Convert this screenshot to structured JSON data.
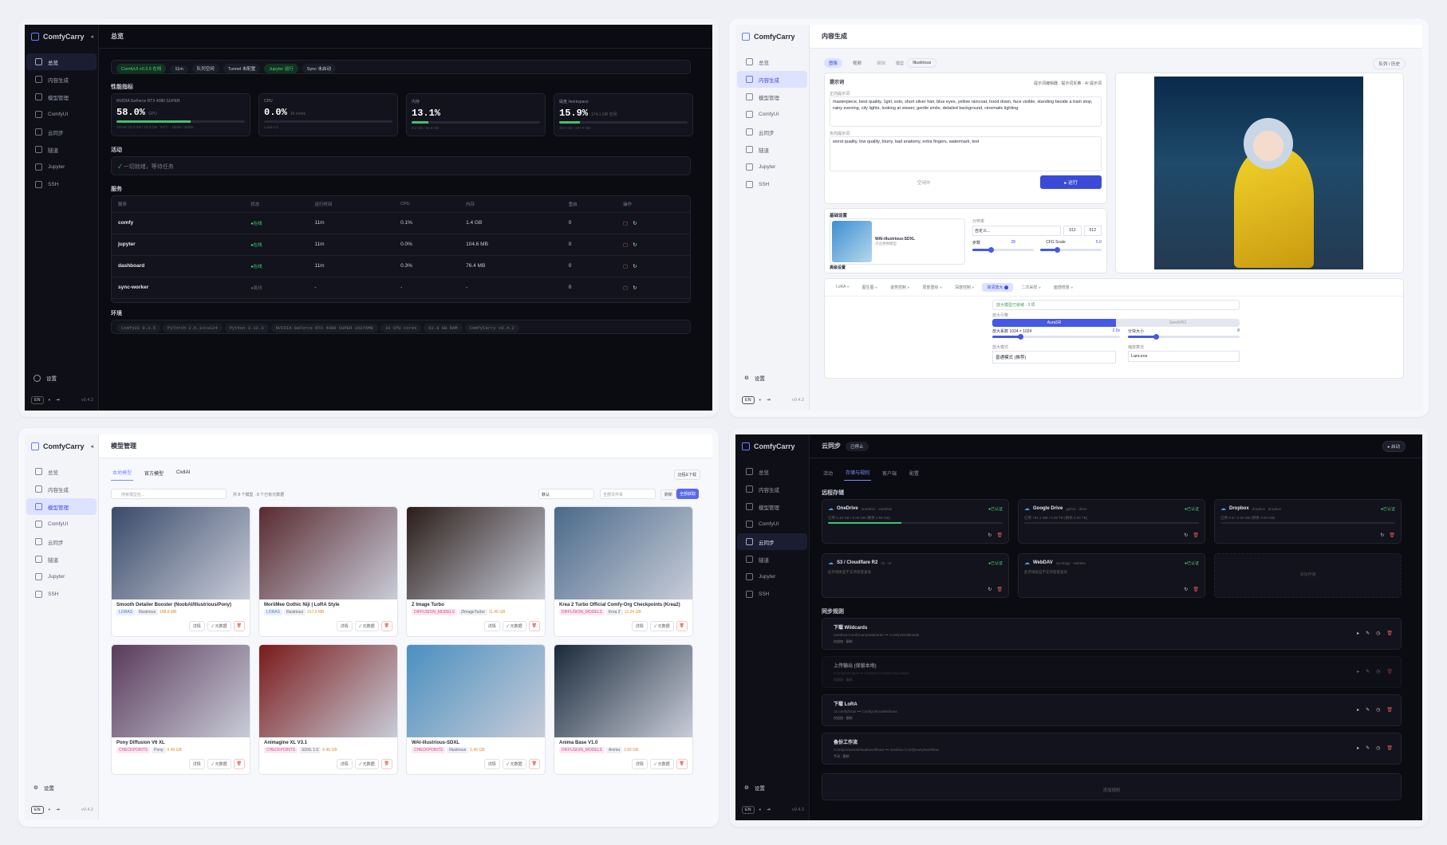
{
  "brand": {
    "name": "ComfyCarry",
    "collapse": "◂"
  },
  "nav": [
    "总览",
    "内容生成",
    "模型管理",
    "ComfyUI",
    "云同步",
    "隧道",
    "Jupyter",
    "SSH"
  ],
  "settings": "设置",
  "footer": {
    "lang": "EN",
    "ver": "v0.4.2"
  },
  "overview": {
    "title": "总览",
    "status": [
      "ComfyUI v0.3.5 在线",
      "11m",
      "队列空闲",
      "Tunnel 未配置",
      "Jupyter 运行",
      "Sync 未启动"
    ],
    "perf_title": "性能指标",
    "metrics": [
      {
        "label": "NVIDIA GeForce RTX 4080 SUPER",
        "value": "58.0%",
        "sub": "GPU",
        "foot": "VRAM 10.0 GB / 16.0 GB · 54°C · 150W / 320W",
        "pct": 58
      },
      {
        "label": "CPU",
        "value": "0.0%",
        "sub": "16 cores",
        "foot": "Load 0.0",
        "pct": 0
      },
      {
        "label": "内存",
        "value": "13.1%",
        "sub": "",
        "foot": "8.2 GB / 62.8 GB",
        "pct": 13.1
      },
      {
        "label": "磁盘 /workspace",
        "value": "15.9%",
        "sub": "174.1 GB 空闲",
        "foot": "32.9 GB / 207.0 GB",
        "pct": 15.9
      }
    ],
    "activity_title": "活动",
    "activity_text": "一切就绪，等待任务",
    "services_title": "服务",
    "svc_headers": [
      "服务",
      "状态",
      "运行时间",
      "CPU",
      "内存",
      "重启",
      "操作"
    ],
    "services": [
      {
        "name": "comfy",
        "status": "●在线",
        "up": "11m",
        "cpu": "0.1%",
        "mem": "1.4 GB",
        "rs": "0"
      },
      {
        "name": "jupyter",
        "status": "●在线",
        "up": "11m",
        "cpu": "0.0%",
        "mem": "104.6 MB",
        "rs": "0"
      },
      {
        "name": "dashboard",
        "status": "●在线",
        "up": "11m",
        "cpu": "0.3%",
        "mem": "76.4 MB",
        "rs": "0"
      },
      {
        "name": "sync-worker",
        "status": "●离线",
        "up": "-",
        "cpu": "-",
        "mem": "-",
        "rs": "0"
      }
    ],
    "env_title": "环境",
    "env": [
      "ComfyUI 0.3.5",
      "PyTorch 2.5.1+cu124",
      "Python 3.12.3",
      "NVIDIA GeForce RTX 4080 SUPER 16376MB",
      "16 CPU cores",
      "62.8 GB RAM",
      "ComfyCarry v0.4.2"
    ]
  },
  "gen": {
    "title": "内容生成",
    "tabs": [
      "图像",
      "视频",
      "编辑"
    ],
    "model_label": "模型",
    "model": "Illustrious",
    "history": "队列 / 历史",
    "prompt_title": "提示词",
    "tools": [
      "提示词编辑器",
      "提示词反推",
      "AI 提示词"
    ],
    "pos_label": "正向提示词",
    "pos": "masterpiece, best quality, 1girl, solo, short silver hair, blue eyes, yellow raincoat, hood down, face visible, standing beside a tram stop, rainy evening, city lights, looking at viewer, gentle smile, detailed background, cinematic lighting",
    "neg_label": "负向提示词",
    "neg": "worst quality, low quality, blurry, bad anatomy, extra fingers, watermark, text",
    "idle": "空闲中",
    "run": "▸ 运行",
    "basic": "基础设置",
    "ckpt": "WAI-illustrious-SDXL",
    "ckpt_sub": "点击更换模型",
    "size_label": "分辨率",
    "size_preset": "自定义...",
    "w": "512",
    "h": "512",
    "steps_label": "步数",
    "steps": "28",
    "cfg_label": "CFG Scale",
    "cfg": "5.0",
    "advanced": "高级设置",
    "modules": [
      "LoRA",
      "图生图",
      "姿势控制",
      "局部重绘",
      "深度控制",
      "高清放大",
      "二次采样",
      "面部修复"
    ],
    "upscale_info": "放大模型已就绪 · 3 项",
    "engine_label": "放大引擎",
    "engines": [
      "AuraSR",
      "SeedVR2"
    ],
    "factor_label": "放大系数 1024 × 1024",
    "factor": "2.0x",
    "tile_label": "分块大小",
    "tile": "8",
    "mode_label": "放大模式",
    "mode": "普通模式 (推荐)",
    "method_label": "缩放算法",
    "method": "Lanczos"
  },
  "models": {
    "title": "模型管理",
    "tabs": [
      "本地模型",
      "官方模型",
      "CivitAI"
    ],
    "search_ph": "搜索模型名...",
    "count": "共 8 个模型 · 8 个已有元数据",
    "sort": "默认",
    "folder": "全部文件夹",
    "refresh": "刷新",
    "fetch": "全部获取",
    "dl": "远程&下载",
    "detail": "详情",
    "meta": "元数据",
    "items": [
      {
        "name": "Smooth Detailer Booster (NoobAI/Illustrious/Pony)",
        "type": "LORAS",
        "base": "Illustrious",
        "size": "188.8 MB",
        "color": "#3a4a6a"
      },
      {
        "name": "MoriiMee Gothic Niji | LoRA Style",
        "type": "LORAS",
        "base": "Illustrious",
        "size": "217.9 MB",
        "color": "#5a2a30"
      },
      {
        "name": "Z Image Turbo",
        "type": "DIFFUSION_MODELS",
        "base": "ZImageTurbo",
        "size": "11.46 GB",
        "color": "#2a1c18"
      },
      {
        "name": "Krea 2 Turbo Official Comfy-Org Checkpoints (Krea2)",
        "type": "DIFFUSION_MODELS",
        "base": "Krea 2",
        "size": "12.24 GB",
        "color": "#4a6a8a"
      },
      {
        "name": "Pony Diffusion V6 XL",
        "type": "CHECKPOINTS",
        "base": "Pony",
        "size": "6.46 GB",
        "color": "#5a3a5a"
      },
      {
        "name": "Animagine XL V3.1",
        "type": "CHECKPOINTS",
        "base": "SDXL 1.0",
        "size": "6.46 GB",
        "color": "#7a1a1a"
      },
      {
        "name": "WAI-illustrious-SDXL",
        "type": "CHECKPOINTS",
        "base": "Illustrious",
        "size": "6.46 GB",
        "color": "#4a90c0"
      },
      {
        "name": "Anima Base V1.0",
        "type": "DIFFUSION_MODELS",
        "base": "Anima",
        "size": "3.89 GB",
        "color": "#1a2a3a"
      }
    ]
  },
  "sync": {
    "title": "云同步",
    "badge": "已停止",
    "start": "▸ 启动",
    "tabs": [
      "活动",
      "存储与规则",
      "客户端",
      "配置"
    ],
    "remote_title": "远程存储",
    "remotes": [
      {
        "name": "OneDrive",
        "type": "onedrive · onedrive",
        "state": "●已认证",
        "usage": "已用 2.10 GB / 5.00 GB (剩余 2.90 GB)",
        "pct": 42
      },
      {
        "name": "Google Drive",
        "type": "gdrive · drive",
        "state": "●已认证",
        "usage": "已用 792.1 MB / 5.00 TB (剩余 5.00 TB)",
        "pct": 0
      },
      {
        "name": "Dropbox",
        "type": "dropbox · dropbox",
        "state": "●已认证",
        "usage": "已用 0 B / 2.00 GB (剩余 2.00 GB)",
        "pct": 0
      },
      {
        "name": "S3 / Cloudflare R2",
        "type": "s3 · r2",
        "state": "●已认证",
        "usage": "此存储类型不支持容量查询",
        "pct": -1
      },
      {
        "name": "WebDAV",
        "type": "synology · webdav",
        "state": "●已认证",
        "usage": "此存储类型不支持容量查询",
        "pct": -1
      }
    ],
    "add_remote": "添加存储",
    "rules_title": "同步规则",
    "rules": [
      {
        "name": "下载 Wildcards",
        "path": "onedrive:ComfyCarry/wildcards ••• ComfyUI/wildcards",
        "tags": "仅追加 · 复制"
      },
      {
        "name": "上传输出 (保留本地)",
        "path": "ComfyUI/output ••• onedrive:ComfyCarry/output",
        "tags": "仅追加 · 复制"
      },
      {
        "name": "下载 LoRA",
        "path": "r2:comfy/loras ••• ComfyUI/models/loras",
        "tags": "仅追加 · 复制"
      },
      {
        "name": "备份工作流",
        "path": "ComfyUI/user/default/workflows ••• onedrive:ComfyCarry/workflow",
        "tags": "手动 · 复制"
      }
    ],
    "add_rule": "添加规则"
  }
}
